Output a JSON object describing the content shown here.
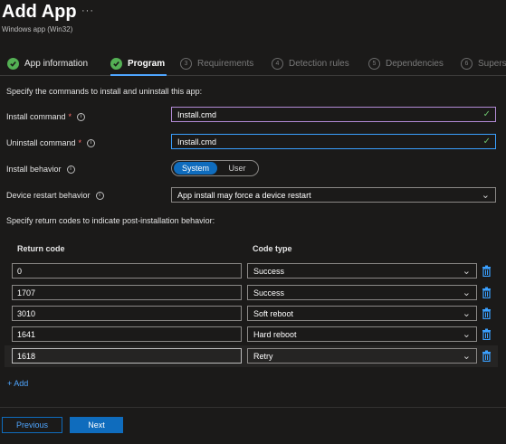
{
  "header": {
    "title": "Add App",
    "more": "···",
    "subtitle": "Windows app (Win32)"
  },
  "wizard": {
    "steps": [
      {
        "label": "App information",
        "badge": "✓",
        "state": "done"
      },
      {
        "label": "Program",
        "badge": "✓",
        "state": "active"
      },
      {
        "label": "Requirements",
        "badge": "3",
        "state": "future"
      },
      {
        "label": "Detection rules",
        "badge": "4",
        "state": "future"
      },
      {
        "label": "Dependencies",
        "badge": "5",
        "state": "future"
      },
      {
        "label": "Supers",
        "badge": "6",
        "state": "future"
      }
    ]
  },
  "program": {
    "intro": "Specify the commands to install and uninstall this app:",
    "install_command": {
      "label": "Install command",
      "required": "*",
      "value": "Install.cmd"
    },
    "uninstall_command": {
      "label": "Uninstall command",
      "required": "*",
      "value": "Install.cmd"
    },
    "install_behavior": {
      "label": "Install behavior",
      "options": [
        "System",
        "User"
      ],
      "selected": "System"
    },
    "device_restart": {
      "label": "Device restart behavior",
      "value": "App install may force a device restart"
    },
    "return_intro": "Specify return codes to indicate post-installation behavior:"
  },
  "return_codes": {
    "headers": {
      "code": "Return code",
      "type": "Code type"
    },
    "rows": [
      {
        "code": "0",
        "type": "Success"
      },
      {
        "code": "1707",
        "type": "Success"
      },
      {
        "code": "3010",
        "type": "Soft reboot"
      },
      {
        "code": "1641",
        "type": "Hard reboot"
      },
      {
        "code": "1618",
        "type": "Retry"
      }
    ],
    "add_label": "+ Add"
  },
  "footer": {
    "previous_label": "Previous",
    "next_label": "Next"
  },
  "colors": {
    "accent": "#0f6cbd",
    "link": "#4fa6ff",
    "success": "#54b054",
    "required": "#ff6b6b"
  }
}
